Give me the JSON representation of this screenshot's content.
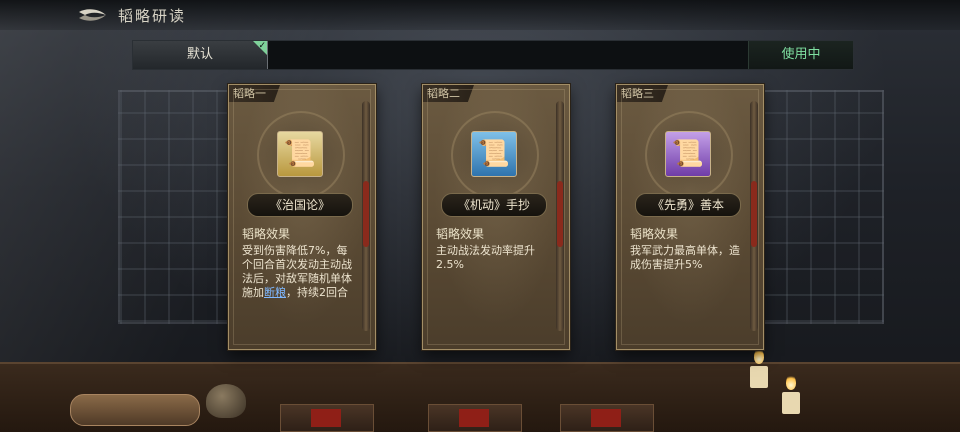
{
  "header": {
    "title": "韬略研读",
    "back_icon": "back-arrow-icon"
  },
  "tabs": {
    "default_label": "默认",
    "status_label": "使用中",
    "active_color": "#7fe0a1"
  },
  "cards": [
    {
      "slot": "韬略一",
      "name": "《治国论》",
      "icon": "scroll-bundle-icon",
      "icon_color": "gold",
      "effect_title": "韬略效果",
      "effect_pre": "受到伤害降低7%，每个回合首次发动主动战法后，对敌军随机单体施加",
      "effect_link": "断粮",
      "effect_post": "，持续2回合"
    },
    {
      "slot": "韬略二",
      "name": "《机动》手抄",
      "icon": "scroll-bundle-icon",
      "icon_color": "blue",
      "effect_title": "韬略效果",
      "effect_text": "主动战法发动率提升2.5%"
    },
    {
      "slot": "韬略三",
      "name": "《先勇》善本",
      "icon": "scroll-bundle-icon",
      "icon_color": "purple",
      "effect_title": "韬略效果",
      "effect_text": "我军武力最高单体，造成伤害提升5%"
    }
  ]
}
